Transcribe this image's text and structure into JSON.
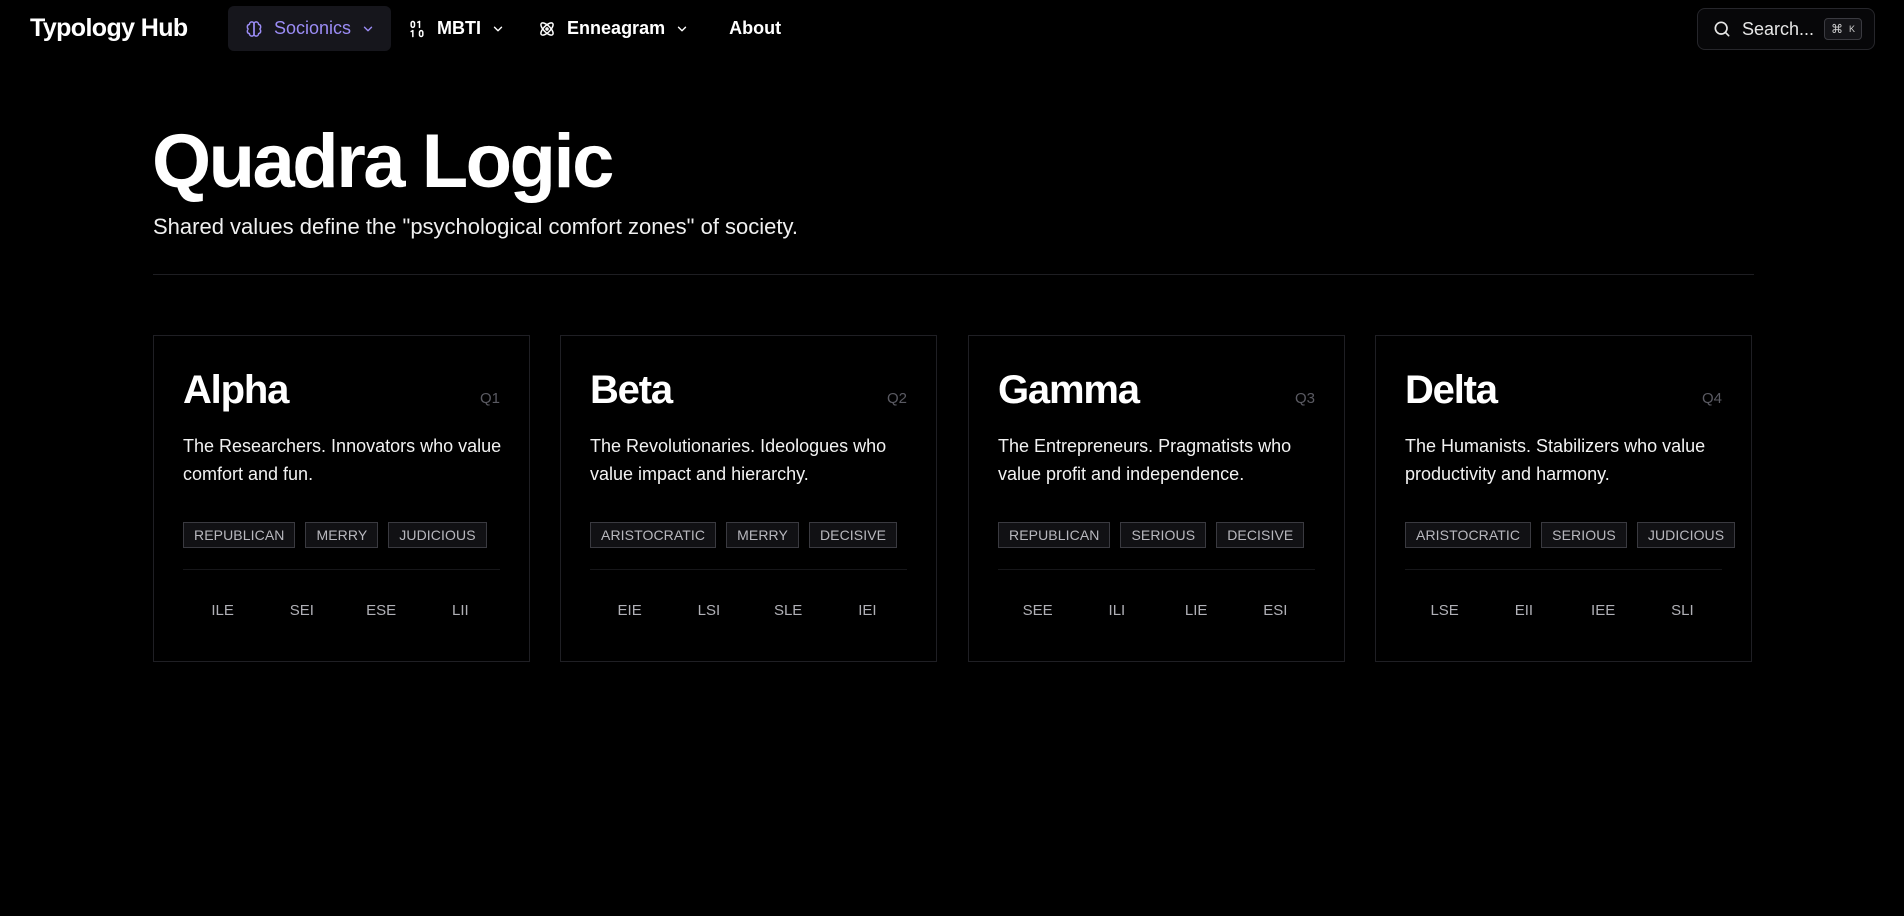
{
  "nav": {
    "brand": "Typology Hub",
    "items": [
      {
        "label": "Socionics",
        "icon": "brain-icon"
      },
      {
        "label": "MBTI",
        "icon": "binary-icon"
      },
      {
        "label": "Enneagram",
        "icon": "atom-icon"
      },
      {
        "label": "About"
      }
    ],
    "search_label": "Search...",
    "search_shortcut": "⌘",
    "search_shortcut_key": "K",
    "accent_color": "#9b8cf5"
  },
  "page": {
    "title": "Quadra Logic",
    "subtitle": "Shared values define the \"psychological comfort zones\" of society."
  },
  "quadras": [
    {
      "name": "Alpha",
      "code": "Q1",
      "description": "The Researchers. Innovators who value comfort and fun.",
      "tags": [
        "REPUBLICAN",
        "MERRY",
        "JUDICIOUS"
      ],
      "types": [
        "ILE",
        "SEI",
        "ESE",
        "LII"
      ]
    },
    {
      "name": "Beta",
      "code": "Q2",
      "description": "The Revolutionaries. Ideologues who value impact and hierarchy.",
      "tags": [
        "ARISTOCRATIC",
        "MERRY",
        "DECISIVE"
      ],
      "types": [
        "EIE",
        "LSI",
        "SLE",
        "IEI"
      ]
    },
    {
      "name": "Gamma",
      "code": "Q3",
      "description": "The Entrepreneurs. Pragmatists who value profit and independence.",
      "tags": [
        "REPUBLICAN",
        "SERIOUS",
        "DECISIVE"
      ],
      "types": [
        "SEE",
        "ILI",
        "LIE",
        "ESI"
      ]
    },
    {
      "name": "Delta",
      "code": "Q4",
      "description": "The Humanists. Stabilizers who value productivity and harmony.",
      "tags": [
        "ARISTOCRATIC",
        "SERIOUS",
        "JUDICIOUS"
      ],
      "types": [
        "LSE",
        "EII",
        "IEE",
        "SLI"
      ]
    }
  ]
}
